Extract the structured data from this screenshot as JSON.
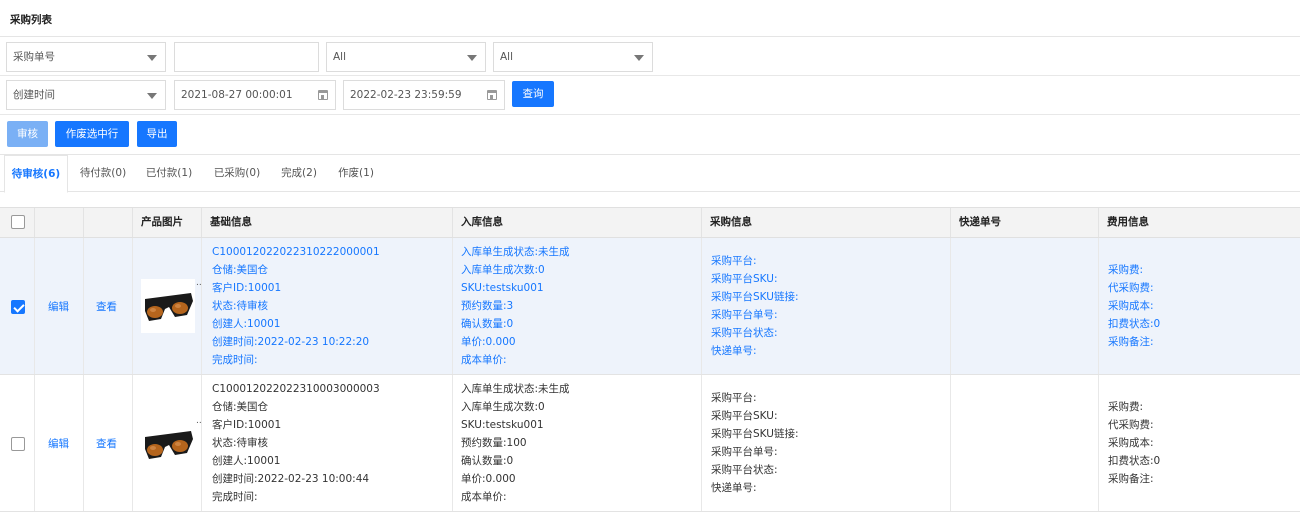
{
  "page_title": "采购列表",
  "filters": {
    "row1": {
      "field_select": "采购单号",
      "search_value": "",
      "select2": "All",
      "select3": "All"
    },
    "row2": {
      "time_select": "创建时间",
      "start_date": "2021-08-27 00:00:01",
      "end_date": "2022-02-23 23:59:59",
      "query_label": "查询"
    }
  },
  "actions": {
    "approve": "审核",
    "void_selected": "作废选中行",
    "export": "导出"
  },
  "tabs": [
    {
      "label": "待审核(6)",
      "active": true
    },
    {
      "label": "待付款(0)",
      "active": false
    },
    {
      "label": "已付款(1)",
      "active": false
    },
    {
      "label": "已采购(0)",
      "active": false
    },
    {
      "label": "完成(2)",
      "active": false
    },
    {
      "label": "作废(1)",
      "active": false
    }
  ],
  "table": {
    "headers": {
      "image": "产品图片",
      "basic": "基础信息",
      "inbound": "入库信息",
      "purchase": "采购信息",
      "tracking": "快递单号",
      "fee": "费用信息"
    },
    "rows": [
      {
        "selected": true,
        "edit": "编辑",
        "view": "查看",
        "basic": {
          "l1": "C10001202202231022200000​1",
          "l2": "仓储:美国仓",
          "l3": "客户ID:10001",
          "l4": "状态:待审核",
          "l5": "创建人:10001",
          "l6": "创建时间:2022-02-23 10:22:20",
          "l7": "完成时间:"
        },
        "inbound": {
          "l1": "入库单生成状态:未生成",
          "l2": "入库单生成次数:0",
          "l3": "SKU:testsku001",
          "l4": "预约数量:3",
          "l5": "确认数量:0",
          "l6": "单价:0.000",
          "l7": "成本单价:"
        },
        "purchase": {
          "l1": "采购平台:",
          "l2": "采购平台SKU:",
          "l3": "采购平台SKU链接:",
          "l4": "采购平台单号:",
          "l5": "采购平台状态:",
          "l6": "快递单号:"
        },
        "fee": {
          "l1": "采购费:",
          "l2": "代采购费:",
          "l3": "采购成本:",
          "l4": "扣费状态:0",
          "l5": "采购备注:"
        }
      },
      {
        "selected": false,
        "edit": "编辑",
        "view": "查看",
        "basic": {
          "l1": "C100012022022310003000003",
          "l2": "仓储:美国仓",
          "l3": "客户ID:10001",
          "l4": "状态:待审核",
          "l5": "创建人:10001",
          "l6": "创建时间:2022-02-23 10:00:44",
          "l7": "完成时间:"
        },
        "inbound": {
          "l1": "入库单生成状态:未生成",
          "l2": "入库单生成次数:0",
          "l3": "SKU:testsku001",
          "l4": "预约数量:100",
          "l5": "确认数量:0",
          "l6": "单价:0.000",
          "l7": "成本单价:"
        },
        "purchase": {
          "l1": "采购平台:",
          "l2": "采购平台SKU:",
          "l3": "采购平台SKU链接:",
          "l4": "采购平台单号:",
          "l5": "采购平台状态:",
          "l6": "快递单号:"
        },
        "fee": {
          "l1": "采购费:",
          "l2": "代采购费:",
          "l3": "采购成本:",
          "l4": "扣费状态:0",
          "l5": "采购备注:"
        }
      }
    ]
  },
  "colors": {
    "primary": "#1677ff",
    "primary_disabled": "#7ab0f5",
    "selected_row_bg": "#eef3fb"
  }
}
